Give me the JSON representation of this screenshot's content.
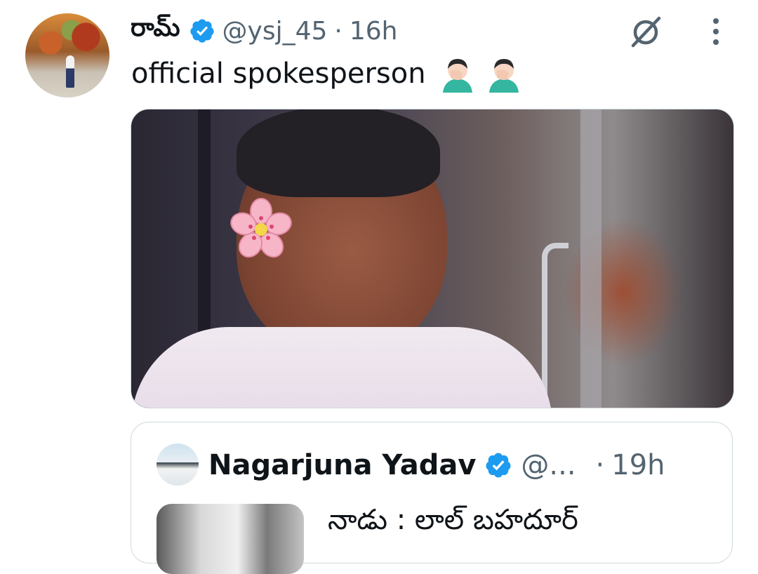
{
  "tweet": {
    "display_name": "రామ్",
    "handle": "@ysj_45",
    "separator": "·",
    "time": "16h",
    "text": "official spokesperson",
    "emojis": [
      "man-facepalming-emoji",
      "man-facepalming-emoji"
    ]
  },
  "quoted": {
    "display_name": "Nagarjuna Yadav",
    "handle": "@...",
    "separator": "·",
    "time": "19h",
    "text": "నాడు : లాల్ బహదూర్"
  },
  "colors": {
    "verified": "#1d9bf0",
    "secondary_text": "#536471",
    "primary_text": "#0f1419",
    "border": "#cfd9de"
  },
  "icons": {
    "grok": "grok-icon",
    "more": "more-icon",
    "verified": "verified-badge-icon"
  }
}
